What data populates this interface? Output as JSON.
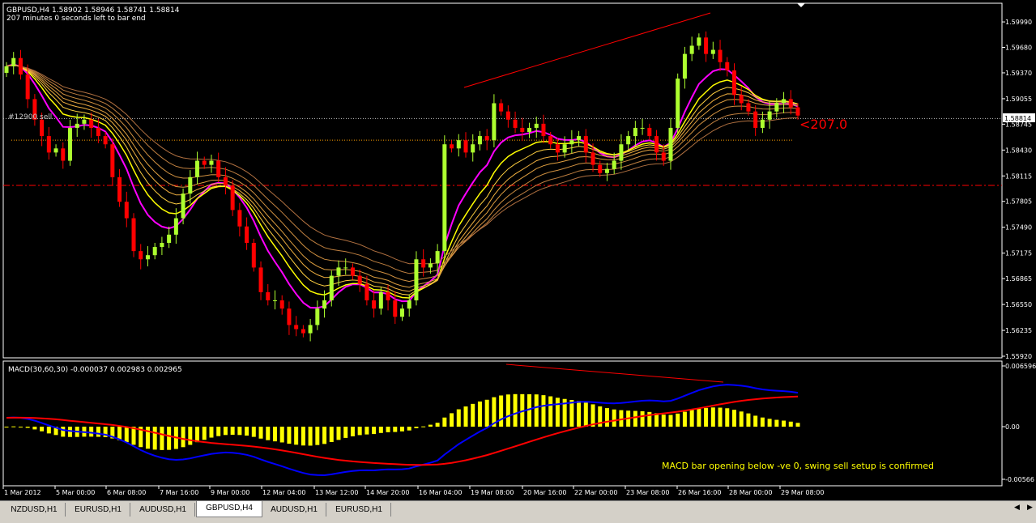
{
  "header": {
    "symbol_line": "GBPUSD,H4  1.58902 1.58946 1.58741 1.58814",
    "timer": "207 minutes 0 seconds left to bar end",
    "sell_label": "#12900 sell"
  },
  "price_axis": {
    "ticks": [
      "1.59990",
      "1.59680",
      "1.59370",
      "1.59055",
      "1.58745",
      "1.58430",
      "1.58115",
      "1.57805",
      "1.57490",
      "1.57175",
      "1.56865",
      "1.56550",
      "1.56235",
      "1.55920"
    ],
    "current_price": "1.58814"
  },
  "annotation_price": "<207.0",
  "macd": {
    "label": "MACD(30,60,30) -0.000037 0.002983 0.002965",
    "ticks": [
      "0.006596",
      "0.00",
      "-0.00566"
    ],
    "note": "MACD bar opening below -ve 0, swing sell setup is confirmed"
  },
  "time_axis": [
    "1 Mar 2012",
    "5 Mar 00:00",
    "6 Mar 08:00",
    "7 Mar 16:00",
    "9 Mar 00:00",
    "12 Mar 04:00",
    "13 Mar 12:00",
    "14 Mar 20:00",
    "16 Mar 04:00",
    "19 Mar 08:00",
    "20 Mar 16:00",
    "22 Mar 00:00",
    "23 Mar 08:00",
    "26 Mar 16:00",
    "28 Mar 00:00",
    "29 Mar 08:00"
  ],
  "tabs": [
    {
      "label": "NZDUSD,H1",
      "active": false
    },
    {
      "label": "EURUSD,H1",
      "active": false
    },
    {
      "label": "AUDUSD,H1",
      "active": false
    },
    {
      "label": "GBPUSD,H4",
      "active": true
    },
    {
      "label": "AUDUSD,H1",
      "active": false
    },
    {
      "label": "EURUSD,H1",
      "active": false
    }
  ],
  "colors": {
    "bull": "#adff2f",
    "bear": "#ff0000",
    "ma_magenta": "#ff00ff",
    "ma_yellow": "#ffff00",
    "ma_orange": "#ffa040",
    "macd_hist": "#ffff00",
    "macd_line": "#0000ff",
    "signal_line": "#ff0000",
    "note_text": "#ffff00",
    "grid_text": "#ffffff"
  },
  "chart_data": {
    "type": "candlestick",
    "symbol": "GBPUSD",
    "timeframe": "H4",
    "x_categories": [
      "1 Mar 2012",
      "5 Mar 00:00",
      "6 Mar 08:00",
      "7 Mar 16:00",
      "9 Mar 00:00",
      "12 Mar 04:00",
      "13 Mar 12:00",
      "14 Mar 20:00",
      "16 Mar 04:00",
      "19 Mar 08:00",
      "20 Mar 16:00",
      "22 Mar 00:00",
      "23 Mar 08:00",
      "26 Mar 16:00",
      "28 Mar 00:00",
      "29 Mar 08:00"
    ],
    "ylim": [
      1.5592,
      1.6003
    ],
    "closes": [
      1.5945,
      1.5955,
      1.5935,
      1.5905,
      1.588,
      1.586,
      1.584,
      1.5845,
      1.583,
      1.587,
      1.5875,
      1.588,
      1.587,
      1.586,
      1.585,
      1.581,
      1.578,
      1.576,
      1.572,
      1.571,
      1.5715,
      1.5725,
      1.573,
      1.574,
      1.576,
      1.579,
      1.581,
      1.583,
      1.5825,
      1.583,
      1.581,
      1.58,
      1.577,
      1.575,
      1.573,
      1.57,
      1.567,
      1.566,
      1.566,
      1.565,
      1.563,
      1.5625,
      1.562,
      1.563,
      1.565,
      1.566,
      1.569,
      1.57,
      1.57,
      1.569,
      1.568,
      1.566,
      1.565,
      1.567,
      1.566,
      1.564,
      1.565,
      1.566,
      1.571,
      1.57,
      1.5705,
      1.572,
      1.585,
      1.5845,
      1.5855,
      1.584,
      1.585,
      1.586,
      1.5855,
      1.59,
      1.589,
      1.588,
      1.587,
      1.5865,
      1.587,
      1.5875,
      1.586,
      1.585,
      1.584,
      1.585,
      1.5855,
      1.586,
      1.584,
      1.5825,
      1.5815,
      1.582,
      1.583,
      1.585,
      1.586,
      1.587,
      1.587,
      1.586,
      1.584,
      1.583,
      1.587,
      1.593,
      1.596,
      1.597,
      1.598,
      1.596,
      1.5965,
      1.595,
      1.594,
      1.591,
      1.59,
      1.589,
      1.587,
      1.588,
      1.589,
      1.59,
      1.5905,
      1.5895,
      1.5885
    ],
    "horizontal_lines": {
      "dotted_white": 1.58814,
      "dashed_red": 1.58,
      "dotted_yellow": 1.5855
    },
    "macd": {
      "params": "30,60,30",
      "ylim": [
        -0.00566,
        0.006596
      ],
      "last_hist": -3.7e-05,
      "last_macd": 0.002983,
      "last_signal": 0.002965
    }
  }
}
